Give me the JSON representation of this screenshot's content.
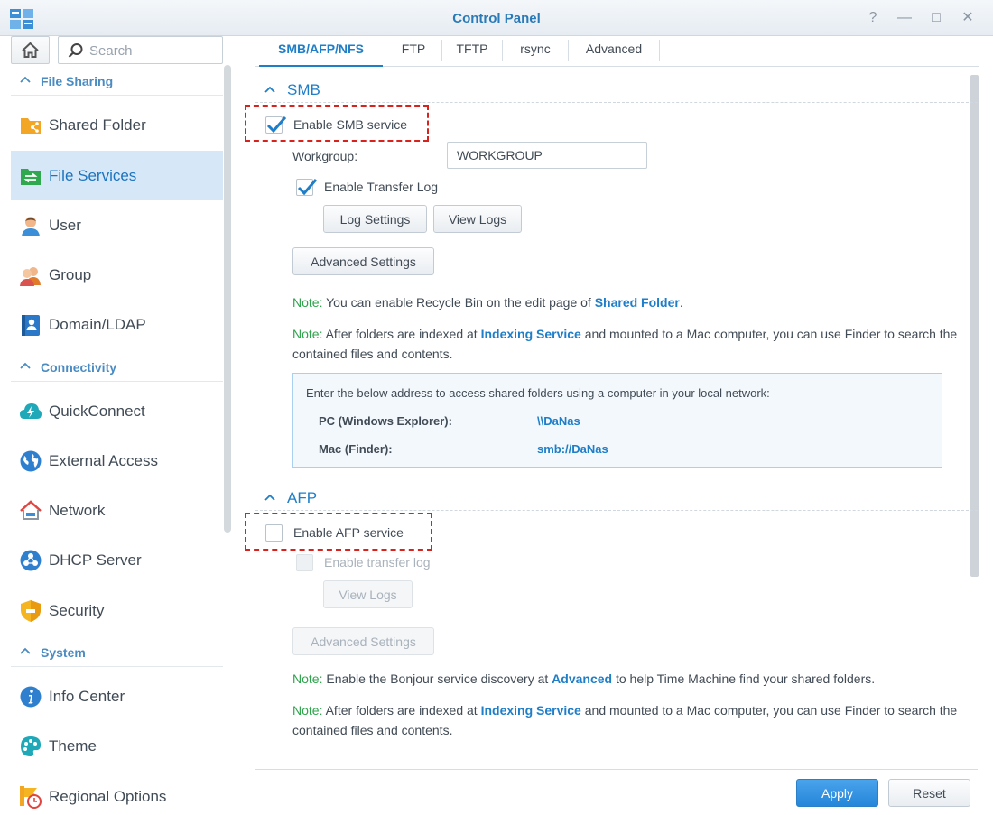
{
  "window": {
    "title": "Control Panel",
    "buttons": [
      "?",
      "—",
      "□",
      "✕"
    ]
  },
  "sidebar": {
    "search_placeholder": "Search",
    "groups": [
      {
        "label": "File Sharing",
        "items": [
          {
            "label": "Shared Folder",
            "icon": "shared-folder-icon"
          },
          {
            "label": "File Services",
            "icon": "file-services-icon",
            "active": true
          },
          {
            "label": "User",
            "icon": "user-icon"
          },
          {
            "label": "Group",
            "icon": "group-icon"
          },
          {
            "label": "Domain/LDAP",
            "icon": "domain-ldap-icon"
          }
        ]
      },
      {
        "label": "Connectivity",
        "items": [
          {
            "label": "QuickConnect",
            "icon": "quickconnect-icon"
          },
          {
            "label": "External Access",
            "icon": "external-access-icon"
          },
          {
            "label": "Network",
            "icon": "network-icon"
          },
          {
            "label": "DHCP Server",
            "icon": "dhcp-server-icon"
          },
          {
            "label": "Security",
            "icon": "security-icon"
          }
        ]
      },
      {
        "label": "System",
        "items": [
          {
            "label": "Info Center",
            "icon": "info-center-icon"
          },
          {
            "label": "Theme",
            "icon": "theme-icon"
          },
          {
            "label": "Regional Options",
            "icon": "regional-options-icon"
          }
        ]
      }
    ]
  },
  "tabs": [
    "SMB/AFP/NFS",
    "FTP",
    "TFTP",
    "rsync",
    "Advanced"
  ],
  "smb": {
    "title": "SMB",
    "enable_label": "Enable SMB service",
    "enabled": true,
    "workgroup_label": "Workgroup:",
    "workgroup_value": "WORKGROUP",
    "transfer_log_label": "Enable Transfer Log",
    "transfer_log_enabled": true,
    "log_settings_btn": "Log Settings",
    "view_logs_btn": "View Logs",
    "advanced_settings_btn": "Advanced Settings",
    "note1": {
      "lead": "Note:",
      "text": " You can enable Recycle Bin on the edit page of ",
      "link": "Shared Folder",
      "tail": "."
    },
    "note2": {
      "lead": "Note:",
      "text": " After folders are indexed at ",
      "link": "Indexing Service",
      "tail": " and mounted to a Mac computer, you can use Finder to search the contained files and contents."
    },
    "info": {
      "intro": "Enter the below address to access shared folders using a computer in your local network:",
      "pc_label": "PC (Windows Explorer):",
      "pc_value": "\\\\DaNas",
      "mac_label": "Mac (Finder):",
      "mac_value": "smb://DaNas"
    }
  },
  "afp": {
    "title": "AFP",
    "enable_label": "Enable AFP service",
    "enabled": false,
    "transfer_log_label": "Enable transfer log",
    "view_logs_btn": "View Logs",
    "advanced_settings_btn": "Advanced Settings",
    "note1": {
      "lead": "Note:",
      "text": " Enable the Bonjour service discovery at ",
      "link": "Advanced",
      "tail": " to help Time Machine find your shared folders."
    },
    "note2": {
      "lead": "Note:",
      "text": " After folders are indexed at ",
      "link": "Indexing Service",
      "tail": " and mounted to a Mac computer, you can use Finder to search the contained files and contents."
    }
  },
  "footer": {
    "apply": "Apply",
    "reset": "Reset"
  },
  "colors": {
    "accent": "#1f7ec8",
    "note_lead": "#2da54b",
    "highlight": "#d9221c",
    "active_bg": "#d6e8f7"
  }
}
